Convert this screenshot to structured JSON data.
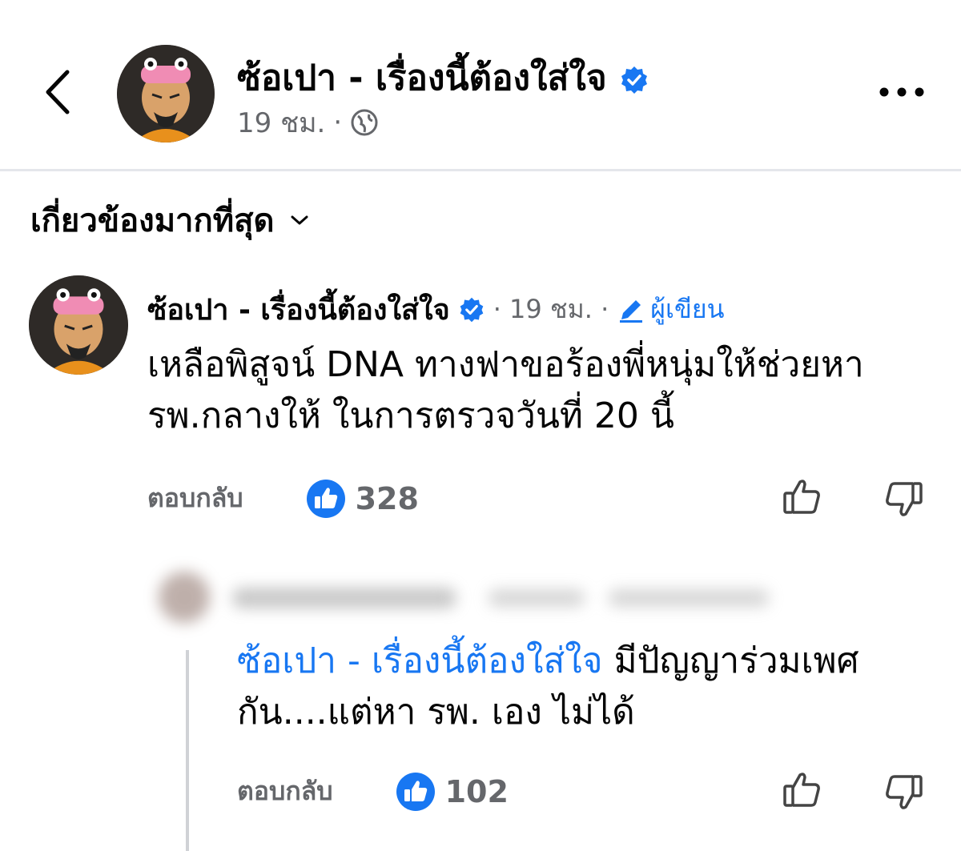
{
  "header": {
    "page_name": "ซ้อเปา - เรื่องนี้ต้องใส่ใจ",
    "time": "19 ชม.",
    "separator": "·",
    "privacy_icon": "globe-icon"
  },
  "sort": {
    "label": "เกี่ยวข้องมากที่สุด",
    "icon": "chevron-down-icon"
  },
  "comments": [
    {
      "author": "ซ้อเปา - เรื่องนี้ต้องใส่ใจ",
      "meta": "· 19 ชม. ·",
      "badge": "ผู้เขียน",
      "text": "เหลือพิสูจน์ DNA ทางฟาขอร้องพี่หนุ่มให้ช่วยหา รพ.กลางให้ ในการตรวจวันที่ 20 นี้",
      "reply_label": "ตอบกลับ",
      "likes": "328"
    }
  ],
  "reply": {
    "mention": "ซ้อเปา - เรื่องนี้ต้องใส่ใจ",
    "text": " มีปัญญาร่วมเพศกัน....แต่หา รพ. เอง ไม่ได้",
    "reply_label": "ตอบกลับ",
    "likes": "102"
  },
  "colors": {
    "accent": "#1877f2",
    "secondary_text": "#65676b",
    "divider": "#e4e6eb"
  }
}
